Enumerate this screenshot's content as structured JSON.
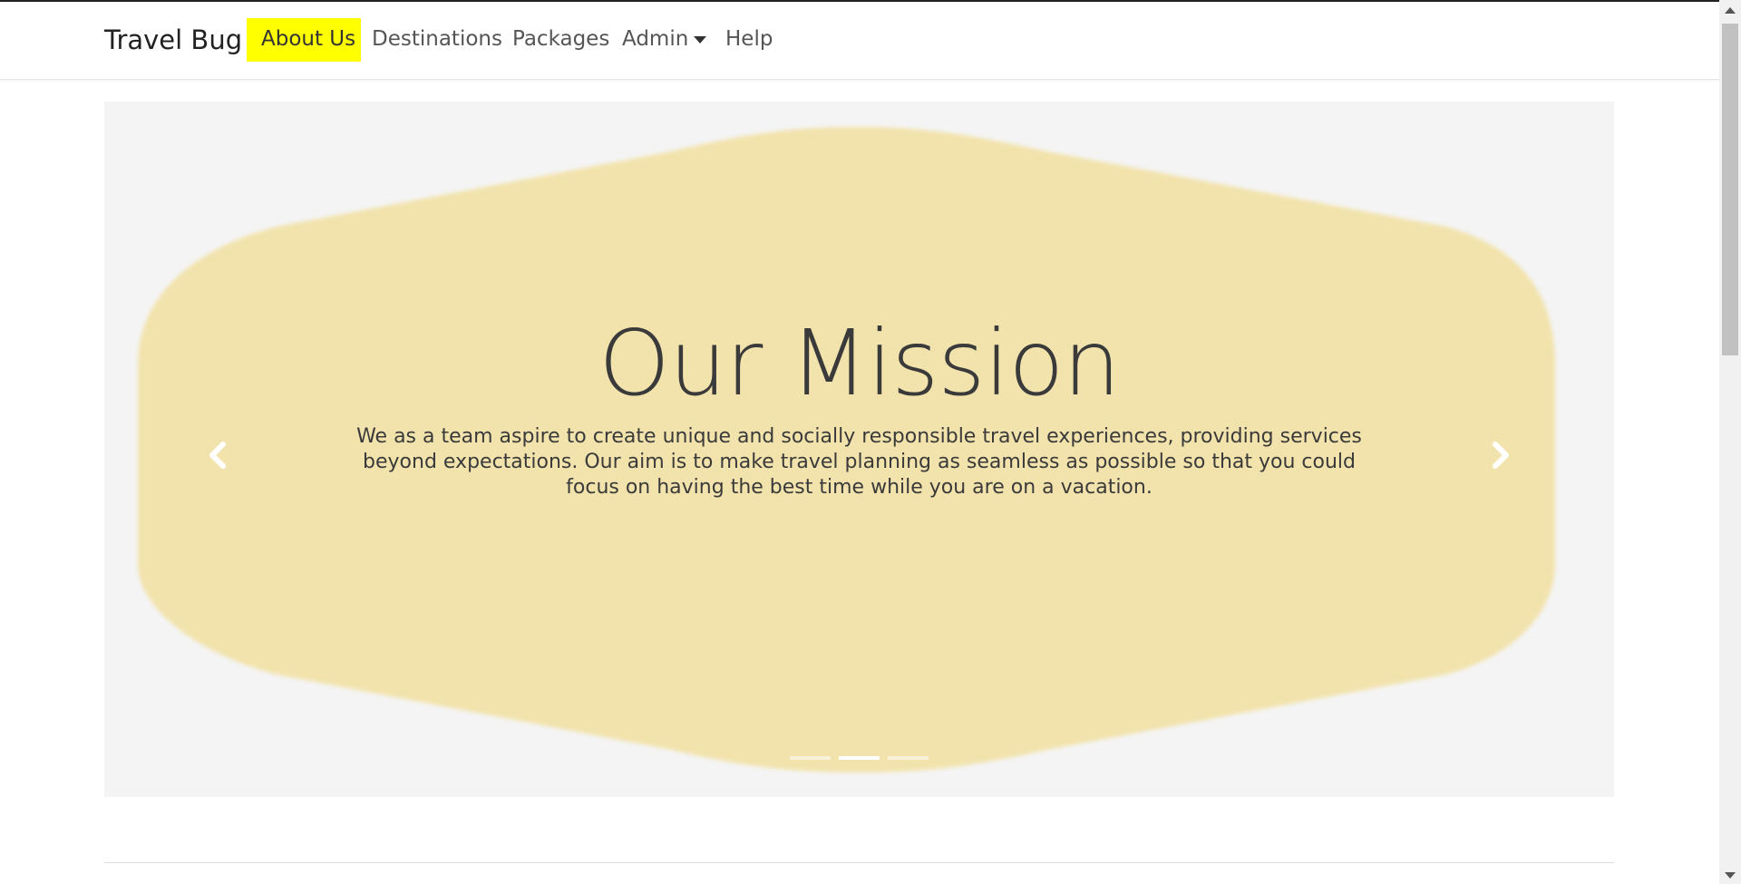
{
  "navbar": {
    "brand": "Travel Bug",
    "items": [
      {
        "label": "About Us",
        "active": true
      },
      {
        "label": "Destinations"
      },
      {
        "label": "Packages"
      },
      {
        "label": "Admin",
        "dropdown": true
      },
      {
        "label": "Help"
      }
    ]
  },
  "carousel": {
    "title": "Our Mission",
    "text": "We as a team aspire to create unique and socially responsible travel experiences, providing services beyond expectations. Our aim is to make travel planning as seamless as possible so that you could focus on having the best time while you are on a vacation.",
    "slide_count": 3,
    "active_slide": 2,
    "prev_icon": "chevron-left-icon",
    "next_icon": "chevron-right-icon"
  },
  "colors": {
    "highlight": "#ffff00",
    "blob": "#f2e3ad",
    "carousel_bg": "#f4f4f4",
    "text": "#3a3a3a"
  }
}
